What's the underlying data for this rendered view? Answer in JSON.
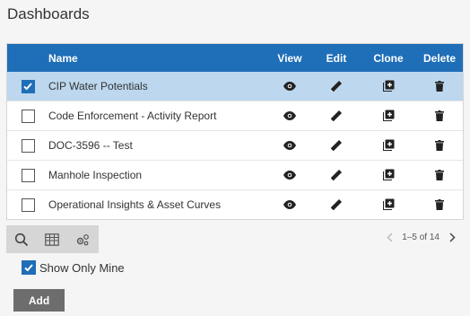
{
  "page": {
    "title": "Dashboards"
  },
  "columns": {
    "name": "Name",
    "view": "View",
    "edit": "Edit",
    "clone": "Clone",
    "delete": "Delete"
  },
  "rows": [
    {
      "name": "CIP Water Potentials",
      "checked": true
    },
    {
      "name": "Code Enforcement - Activity Report",
      "checked": false
    },
    {
      "name": "DOC-3596 -- Test",
      "checked": false
    },
    {
      "name": "Manhole Inspection",
      "checked": false
    },
    {
      "name": "Operational Insights & Asset Curves",
      "checked": false
    }
  ],
  "toolbar": {
    "icons": [
      "search-icon",
      "table-icon",
      "settings-icon"
    ]
  },
  "pager": {
    "text": "1–5 of 14"
  },
  "filter": {
    "show_only_mine_label": "Show Only Mine",
    "show_only_mine_checked": true
  },
  "actions": {
    "add_label": "Add"
  },
  "colors": {
    "header": "#1f6eb8",
    "selected_row": "#bcd7ee",
    "add_button": "#6d6d6d"
  }
}
